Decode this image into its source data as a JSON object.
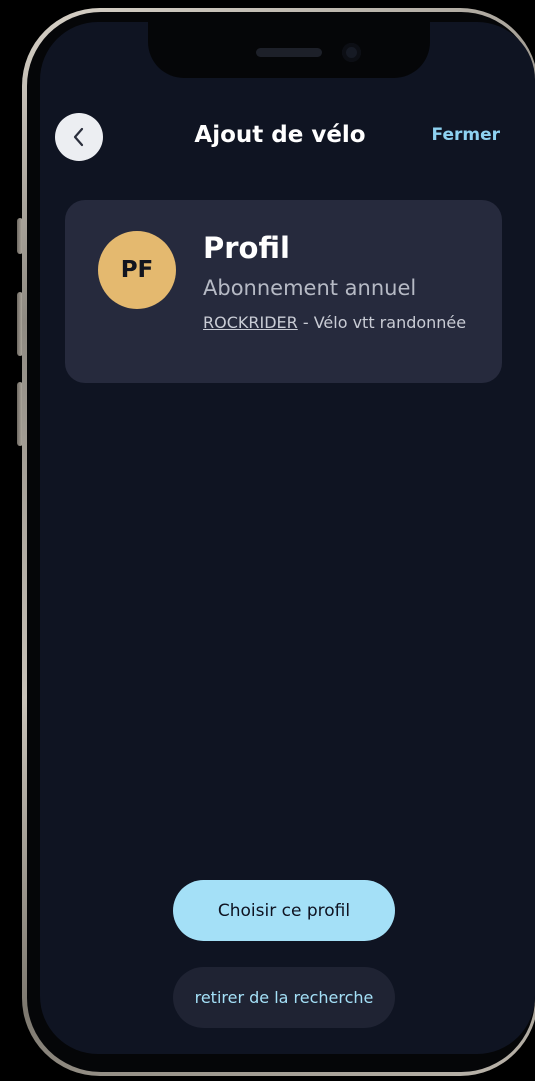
{
  "header": {
    "title": "Ajout de vélo",
    "close_label": "Fermer",
    "back_icon": "chevron-left-icon"
  },
  "profile_card": {
    "avatar_initials": "PF",
    "name": "Profil",
    "subscription": "Abonnement annuel",
    "bike_brand": "ROCKRIDER",
    "bike_description": " - Vélo vtt randonnée"
  },
  "actions": {
    "choose_label": "Choisir ce profil",
    "remove_label": "retirer de la recherche"
  },
  "colors": {
    "screen_background": "#0f1422",
    "card_background": "#262a3d",
    "avatar_background": "#e4b96f",
    "accent": "#8ed2f1",
    "primary_button": "#a4e0f7"
  }
}
